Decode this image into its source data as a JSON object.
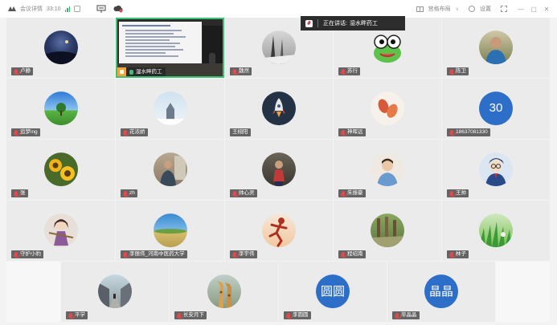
{
  "topbar": {
    "meeting_details": "会议详情",
    "timer": "33:10",
    "layout_label": "宫格布局",
    "settings_label": "设置",
    "window_controls": [
      "—",
      "▢",
      "✕"
    ]
  },
  "speaking_toast": {
    "prefix": "正在讲话:",
    "speaker": "湿水畔药工"
  },
  "share_tile": {
    "name": "湿水畔药工"
  },
  "tiles": [
    {
      "name": "卢静"
    },
    {
      "name": "魏然"
    },
    {
      "name": "苏行"
    },
    {
      "name": "陈卫"
    },
    {
      "name": "追梦ing"
    },
    {
      "name": "花浓娇"
    },
    {
      "name": "王栩阳"
    },
    {
      "name": "神晖远"
    },
    {
      "name": "18637081330",
      "avatar_text": "30"
    },
    {
      "name": "张"
    },
    {
      "name": "zh"
    },
    {
      "name": "帅心灵"
    },
    {
      "name": "朱振豪"
    },
    {
      "name": "王帅"
    },
    {
      "name": "守护小豹"
    },
    {
      "name": "李丽伟_河南中医药大学"
    },
    {
      "name": "李宇伟"
    },
    {
      "name": "程绍南"
    },
    {
      "name": "林子"
    },
    {
      "name": "平学"
    },
    {
      "name": "长安月下"
    },
    {
      "name": "李圆圆",
      "avatar_text": "圆圆"
    },
    {
      "name": "毕晶晶",
      "avatar_text": "晶晶"
    }
  ],
  "colors": {
    "accent_green": "#3fbf74",
    "avatar_blue": "#2d6fc8",
    "mic_red": "#e04a4a"
  }
}
